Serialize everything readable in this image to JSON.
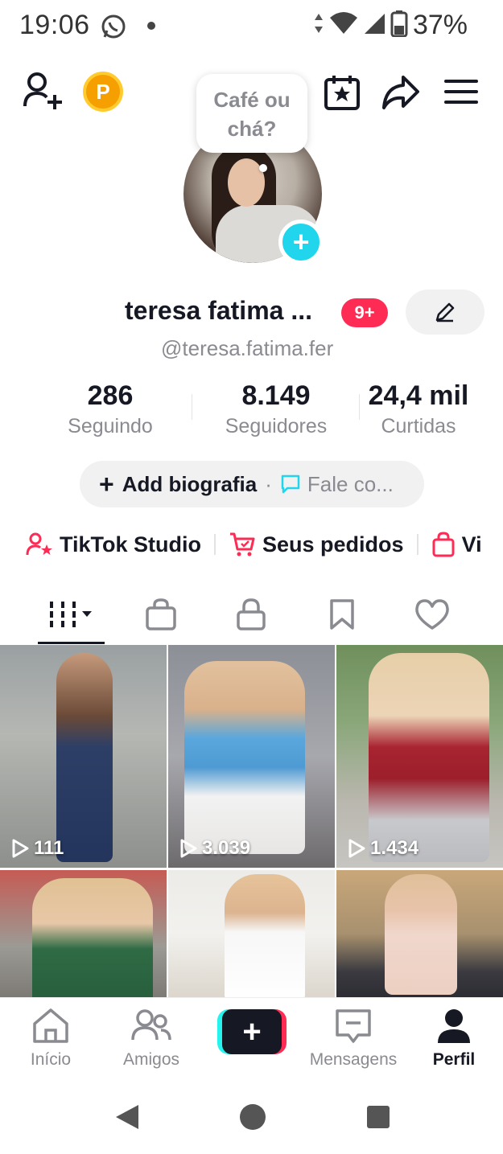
{
  "status_bar": {
    "time": "19:06",
    "battery": "37%"
  },
  "speech_bubble": {
    "line1": "Café ou",
    "line2": "chá?"
  },
  "profile": {
    "name": "teresa fatima ...",
    "badge": "9+",
    "handle": "@teresa.fatima.fer"
  },
  "stats": [
    {
      "value": "286",
      "label": "Seguindo"
    },
    {
      "value": "8.149",
      "label": "Seguidores"
    },
    {
      "value": "24,4 mil",
      "label": "Curtidas"
    }
  ],
  "bio": {
    "add_label": "Add biografia",
    "separator": "·",
    "chat_label": "Fale co..."
  },
  "shortcuts": [
    {
      "label": "TikTok Studio"
    },
    {
      "label": "Seus pedidos"
    },
    {
      "label": "Vi"
    }
  ],
  "videos": [
    {
      "views": "111"
    },
    {
      "views": "3.039"
    },
    {
      "views": "1.434"
    }
  ],
  "bottom_nav": [
    {
      "label": "Início"
    },
    {
      "label": "Amigos"
    },
    {
      "label": "Mensagens"
    },
    {
      "label": "Perfil"
    }
  ],
  "colors": {
    "accent_red": "#fe2c55",
    "accent_cyan": "#20d5ec",
    "coin": "#f5a000"
  }
}
